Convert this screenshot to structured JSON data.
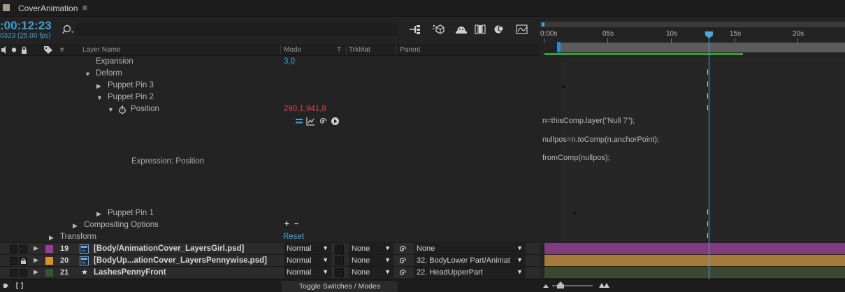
{
  "tab": {
    "title": "CoverAnimation",
    "menu_glyph": "≡"
  },
  "header": {
    "timecode": ":00:12:23",
    "fps": "0323 (25.00 fps)"
  },
  "columns": {
    "hash": "#",
    "layer_name": "Layer Name",
    "mode": "Mode",
    "t": "T",
    "trkmat": "TrkMat",
    "parent": "Parent"
  },
  "props": {
    "expansion": {
      "label": "Expansion",
      "value": "3,0"
    },
    "deform": "Deform",
    "pin3": "Puppet Pin 3",
    "pin2": "Puppet Pin 2",
    "position": {
      "label": "Position",
      "value": "290,1,941,8"
    },
    "expr_label": "Expression: Position",
    "pin1": "Puppet Pin 1",
    "compositing": {
      "label": "Compositing Options",
      "value": "+ −"
    },
    "transform": {
      "label": "Transform",
      "value": "Reset"
    }
  },
  "expression_lines": [
    "n=thisComp.layer(\"Null 7\");",
    "nullpos=n.toComp(n.anchorPoint);",
    "fromComp(nullpos);"
  ],
  "ruler": {
    "labels": [
      "0:00s",
      "05s",
      "10s",
      "15s",
      "20s"
    ]
  },
  "layers": [
    {
      "num": "19",
      "name": "[Body/AnimationCover_LayersGirl.psd]",
      "mode": "Normal",
      "trkmat": "None",
      "parent": "None",
      "color": "#9b3a99",
      "bar_color": "#7e3d7e",
      "locked": false
    },
    {
      "num": "20",
      "name": "[BodyUp...ationCover_LayersPennywise.psd]",
      "mode": "Normal",
      "trkmat": "None",
      "parent": "32. BodyLower Part/Animat",
      "color": "#e0902a",
      "bar_color": "#a57a3a",
      "locked": true
    },
    {
      "num": "21",
      "name": "LashesPennyFront",
      "mode": "Normal",
      "trkmat": "None",
      "parent": "22. HeadUpperPart",
      "color": "#2e5a2e",
      "bar_color": "#3a4a32",
      "locked": false
    }
  ],
  "footer": {
    "toggle": "Toggle Switches / Modes"
  },
  "colors": {
    "accent": "#3e9fd0",
    "cti": "#4ba8e4",
    "keyframe_value": "#d6443f"
  }
}
